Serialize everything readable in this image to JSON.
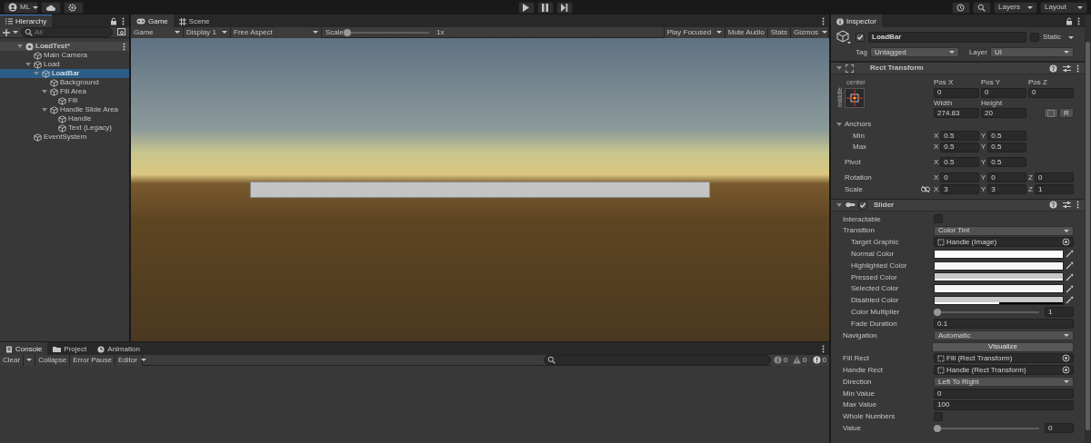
{
  "toolbar": {
    "account": "ML",
    "layers": "Layers",
    "layout": "Layout"
  },
  "hierarchy": {
    "title": "Hierarchy",
    "search_placeholder": "All",
    "items": [
      {
        "label": "LoadTest*",
        "kind": "scene",
        "expanded": true,
        "selected": false,
        "children": [
          {
            "label": "Main Camera",
            "kind": "object",
            "selected": false
          },
          {
            "label": "Load",
            "kind": "object",
            "expanded": true,
            "selected": false,
            "children": [
              {
                "label": "LoadBar",
                "kind": "object",
                "expanded": true,
                "selected": true,
                "children": [
                  {
                    "label": "Background",
                    "kind": "object",
                    "selected": false
                  },
                  {
                    "label": "Fill Area",
                    "kind": "object",
                    "expanded": true,
                    "selected": false,
                    "children": [
                      {
                        "label": "Fill",
                        "kind": "object",
                        "selected": false
                      }
                    ]
                  },
                  {
                    "label": "Handle Slide Area",
                    "kind": "object",
                    "expanded": true,
                    "selected": false,
                    "children": [
                      {
                        "label": "Handle",
                        "kind": "object",
                        "selected": false
                      },
                      {
                        "label": "Text (Legacy)",
                        "kind": "object",
                        "selected": false
                      }
                    ]
                  }
                ]
              }
            ]
          },
          {
            "label": "EventSystem",
            "kind": "object",
            "selected": false
          }
        ]
      }
    ]
  },
  "game": {
    "tabs": [
      {
        "label": "Game",
        "kind": "game",
        "selected": true
      },
      {
        "label": "Scene",
        "kind": "scene",
        "selected": false
      }
    ],
    "view_mode": "Game",
    "display": "Display 1",
    "aspect": "Free Aspect",
    "scale_label": "Scale",
    "scale": {
      "level": 0
    },
    "scale_value": "1x",
    "play_mode": "Play Focused",
    "mute": "Mute Audio",
    "stats": "Stats",
    "gizmos": "Gizmos"
  },
  "console": {
    "tabs": [
      {
        "label": "Console",
        "kind": "console",
        "selected": true
      },
      {
        "label": "Project",
        "kind": "project",
        "selected": false
      },
      {
        "label": "Animation",
        "kind": "animation",
        "selected": false
      }
    ],
    "clear": "Clear",
    "collapse": "Collapse",
    "error_pause": "Error Pause",
    "editor": "Editor",
    "counters": [
      {
        "kind": "info",
        "count": "0"
      },
      {
        "kind": "warning",
        "count": "0"
      },
      {
        "kind": "error",
        "count": "0"
      }
    ]
  },
  "inspector": {
    "title": "Inspector",
    "object": {
      "active": true,
      "name": "LoadBar",
      "static": false,
      "static_label": "Static",
      "tag_label": "Tag",
      "tag": "Untagged",
      "layer_label": "Layer",
      "layer": "UI"
    },
    "rect_transform": {
      "title": "Rect Transform",
      "expanded": true,
      "anchor_h": "center",
      "anchor_v": "middle",
      "fields": [
        {
          "label": "Pos X",
          "value": "0"
        },
        {
          "label": "Pos Y",
          "value": "0"
        },
        {
          "label": "Pos Z",
          "value": "0"
        },
        {
          "label": "Width",
          "value": "274.83"
        },
        {
          "label": "Height",
          "value": "20"
        }
      ],
      "raw_button": "R",
      "vectors": [
        {
          "kind": "group",
          "label": "Anchors",
          "expanded": true,
          "children": [
            {
              "kind": "vector",
              "label": "Min",
              "axes": [
                {
                  "axis": "X",
                  "value": "0.5"
                },
                {
                  "axis": "Y",
                  "value": "0.5"
                }
              ]
            },
            {
              "kind": "vector",
              "label": "Max",
              "axes": [
                {
                  "axis": "X",
                  "value": "0.5"
                },
                {
                  "axis": "Y",
                  "value": "0.5"
                }
              ]
            }
          ]
        },
        {
          "kind": "vector",
          "label": "Pivot",
          "axes": [
            {
              "axis": "X",
              "value": "0.5"
            },
            {
              "axis": "Y",
              "value": "0.5"
            }
          ]
        },
        {
          "kind": "vector",
          "label": "Rotation",
          "axes": [
            {
              "axis": "X",
              "value": "0"
            },
            {
              "axis": "Y",
              "value": "0"
            },
            {
              "axis": "Z",
              "value": "0"
            }
          ]
        },
        {
          "kind": "linked",
          "label": "Scale",
          "axes": [
            {
              "axis": "X",
              "value": "3"
            },
            {
              "axis": "Y",
              "value": "3"
            },
            {
              "axis": "Z",
              "value": "1"
            }
          ]
        }
      ]
    },
    "slider": {
      "title": "Slider",
      "enabled": true,
      "expanded": true,
      "rows": [
        {
          "kind": "checkbox",
          "label": "Interactable",
          "checked": false
        },
        {
          "kind": "dropdown",
          "label": "Transition",
          "value": "Color Tint",
          "children": [
            {
              "kind": "object",
              "label": "Target Graphic",
              "value": "Handle (Image)"
            },
            {
              "kind": "color",
              "label": "Normal Color",
              "color": "#ffffff",
              "level": 1
            },
            {
              "kind": "color",
              "label": "Highlighted Color",
              "color": "#f5f5f5",
              "level": 1
            },
            {
              "kind": "color",
              "label": "Pressed Color",
              "color": "#c8c8c8",
              "level": 1
            },
            {
              "kind": "color",
              "label": "Selected Color",
              "color": "#f5f5f5",
              "level": 1
            },
            {
              "kind": "color",
              "label": "Disabled Color",
              "color": "#c8c8c8",
              "level": 0.5
            },
            {
              "kind": "slider",
              "label": "Color Multiplier",
              "level": 0,
              "value": "1"
            },
            {
              "kind": "text",
              "label": "Fade Duration",
              "value": "0.1"
            }
          ]
        },
        {
          "kind": "dropdown",
          "label": "Navigation",
          "value": "Automatic"
        },
        {
          "kind": "button",
          "label": "Visualize"
        },
        {
          "kind": "object",
          "label": "Fill Rect",
          "value": "Fill (Rect Transform)"
        },
        {
          "kind": "object",
          "label": "Handle Rect",
          "value": "Handle (Rect Transform)"
        },
        {
          "kind": "dropdown",
          "label": "Direction",
          "value": "Left To Right"
        },
        {
          "kind": "text",
          "label": "Min Value",
          "value": "0"
        },
        {
          "kind": "text",
          "label": "Max Value",
          "value": "100"
        },
        {
          "kind": "checkbox",
          "label": "Whole Numbers",
          "checked": false
        },
        {
          "kind": "slider",
          "label": "Value",
          "level": 0,
          "value": "0"
        }
      ]
    }
  }
}
